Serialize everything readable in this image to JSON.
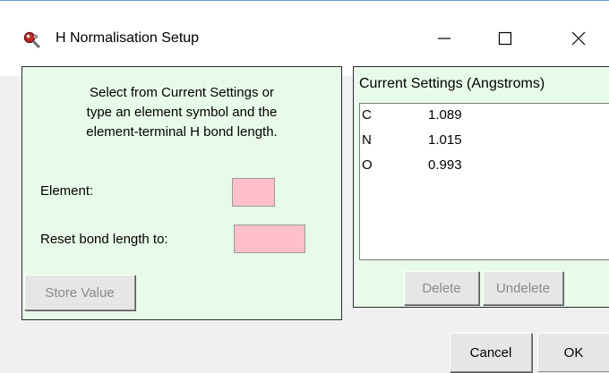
{
  "window": {
    "title": "H Normalisation Setup",
    "app_icon": "magnifier-molecule-icon",
    "controls": [
      "minimize-icon",
      "maximize-icon",
      "close-icon"
    ]
  },
  "left_panel": {
    "instructions": [
      "Select from Current Settings or",
      "type an element symbol and the",
      "element-terminal H bond length."
    ],
    "element_label": "Element:",
    "element_value": "",
    "reset_label": "Reset bond length to:",
    "reset_value": "",
    "store_button": "Store Value"
  },
  "right_panel": {
    "header": "Current Settings (Angstroms)",
    "settings": [
      {
        "element": "C",
        "length": "1.089"
      },
      {
        "element": "N",
        "length": "1.015"
      },
      {
        "element": "O",
        "length": "0.993"
      }
    ],
    "delete_button": "Delete",
    "undelete_button": "Undelete"
  },
  "footer": {
    "cancel_button": "Cancel",
    "ok_button": "OK"
  },
  "colors": {
    "panel_bg": "#e8fbea",
    "input_bg": "#ffc0cb",
    "window_bg": "#f0f0f0"
  }
}
